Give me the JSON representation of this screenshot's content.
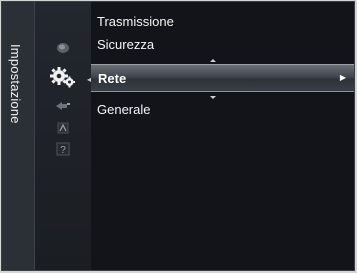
{
  "panel": {
    "title": "Impostazione"
  },
  "menu": {
    "items": [
      {
        "label": "Trasmissione"
      },
      {
        "label": "Sicurezza"
      },
      {
        "label": "Rete"
      },
      {
        "label": "Generale"
      }
    ],
    "selected": "Rete"
  },
  "icons": [
    {
      "name": "picture-icon"
    },
    {
      "name": "settings-gear-icon"
    },
    {
      "name": "input-icon"
    },
    {
      "name": "application-icon"
    },
    {
      "name": "support-icon"
    }
  ],
  "colors": {
    "background": "#0d1016",
    "highlight": "#4a4f57",
    "text": "#f5f5f5"
  }
}
